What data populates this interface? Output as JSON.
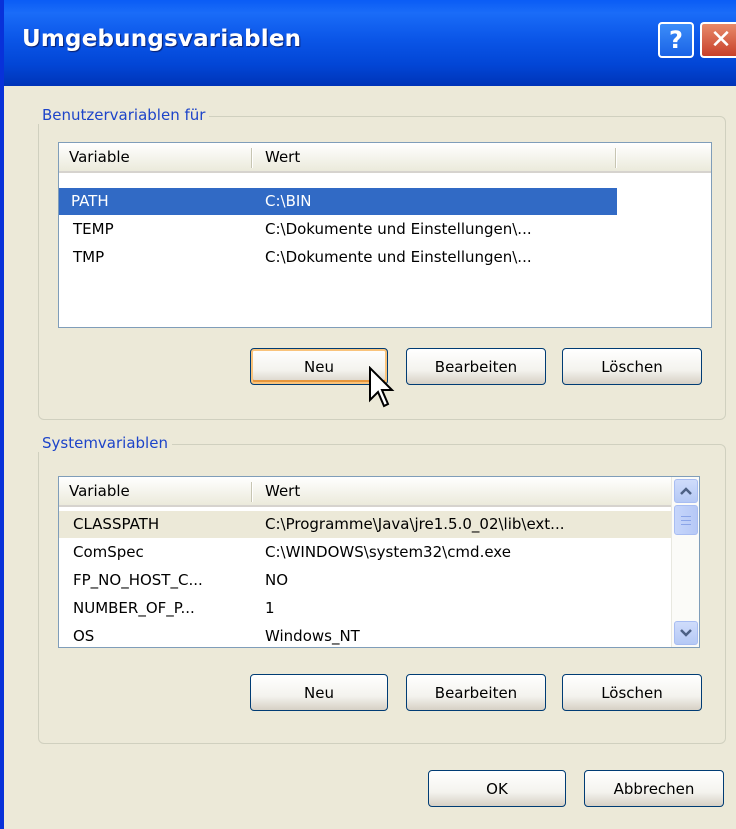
{
  "window": {
    "title": "Umgebungsvariablen"
  },
  "title_buttons": {
    "help": "?",
    "close": "✕"
  },
  "user_group": {
    "label": "Benutzervariablen für",
    "columns": [
      "Variable",
      "Wert"
    ],
    "rows": [
      {
        "variable": "PATH",
        "value": "C:\\BIN",
        "selected": true
      },
      {
        "variable": "TEMP",
        "value": "C:\\Dokumente und Einstellungen\\..."
      },
      {
        "variable": "TMP",
        "value": "C:\\Dokumente und Einstellungen\\..."
      }
    ],
    "buttons": {
      "new": "Neu",
      "edit": "Bearbeiten",
      "delete": "Löschen"
    }
  },
  "system_group": {
    "label": "Systemvariablen",
    "columns": [
      "Variable",
      "Wert"
    ],
    "rows": [
      {
        "variable": "CLASSPATH",
        "value": "C:\\Programme\\Java\\jre1.5.0_02\\lib\\ext...",
        "selected": true
      },
      {
        "variable": "ComSpec",
        "value": "C:\\WINDOWS\\system32\\cmd.exe"
      },
      {
        "variable": "FP_NO_HOST_C...",
        "value": "NO"
      },
      {
        "variable": "NUMBER_OF_P...",
        "value": "1"
      },
      {
        "variable": "OS",
        "value": "Windows_NT"
      }
    ],
    "buttons": {
      "new": "Neu",
      "edit": "Bearbeiten",
      "delete": "Löschen"
    }
  },
  "dialog_buttons": {
    "ok": "OK",
    "cancel": "Abbrechen"
  },
  "colors": {
    "titlebar": "#0a5cf6",
    "selection": "#316ac5",
    "group_label": "#1d44c9",
    "dialog_bg": "#ece9d8"
  }
}
